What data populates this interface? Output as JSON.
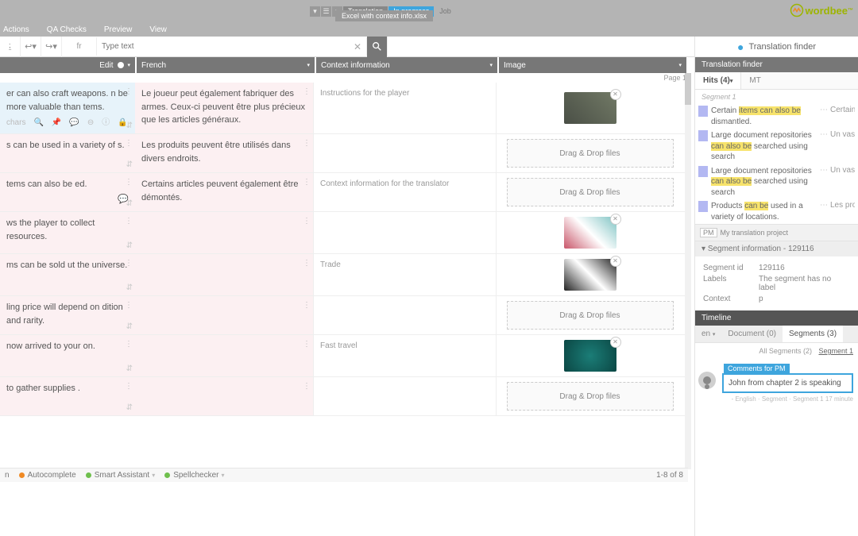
{
  "breadcrumb": {
    "translation": "Translation",
    "progress": "In progress",
    "job": "Job",
    "file": "Excel with context info.xlsx"
  },
  "brand": "wordbee",
  "menu": {
    "actions": "Actions",
    "qa": "QA Checks",
    "preview": "Preview",
    "view": "View"
  },
  "toolbar": {
    "lang": "fr",
    "type_ph": "Type text",
    "page": "1"
  },
  "cols": {
    "edit": "Edit",
    "fr": "French",
    "ctx": "Context information",
    "img": "Image"
  },
  "page_label": "Page 1",
  "drop": "Drag & Drop files",
  "chars": "chars",
  "rows": [
    {
      "en": "er can also craft weapons. n be more valuable than tems.",
      "fr": "Le joueur peut également fabriquer des armes. Ceux-ci peuvent être plus précieux que les articles généraux.",
      "ctx": "Instructions for the player",
      "img": "th1"
    },
    {
      "en": "s can be used in a variety of s.",
      "fr": "Les produits peuvent être utilisés dans divers endroits.",
      "ctx": "",
      "img": "drop"
    },
    {
      "en": "tems can also be ed.",
      "fr": "Certains articles peuvent également être démontés.",
      "ctx": "Context information for the translator",
      "img": "drop"
    },
    {
      "en": "ws the player to collect resources.",
      "fr": "",
      "ctx": "",
      "img": "th2"
    },
    {
      "en": "ms can be sold ut the universe.",
      "fr": "",
      "ctx": "Trade",
      "img": "th3"
    },
    {
      "en": "ling price will depend on dition and rarity.",
      "fr": "",
      "ctx": "",
      "img": "drop"
    },
    {
      "en": " now arrived to your on.",
      "fr": "",
      "ctx": "Fast travel",
      "img": "th4"
    },
    {
      "en": " to gather supplies .",
      "fr": "",
      "ctx": "",
      "img": "drop"
    }
  ],
  "status": {
    "autocomplete": "Autocomplete",
    "smart": "Smart Assistant",
    "spell": "Spellchecker",
    "range": "1-8 of 8"
  },
  "panel": {
    "title": "Translation finder",
    "sub": "Translation finder",
    "tabs": {
      "hits": "Hits (4)",
      "mt": "MT"
    },
    "segment": "Segment 1",
    "hits": [
      {
        "src_pre": "Certain ",
        "src_hl": "items can also be",
        "src_post": " dismantled.",
        "tgt": "Certains également"
      },
      {
        "src_pre": "Large document repositories ",
        "src_hl": "can also be",
        "src_post": " searched using search",
        "tgt": "Un vaste peut aus"
      },
      {
        "src_pre": "Large document repositories ",
        "src_hl": "can also be",
        "src_post": " searched using search",
        "tgt": "Un vaste peut aus"
      },
      {
        "src_pre": "Products ",
        "src_hl": "can be",
        "src_post": " used in a variety of locations.",
        "tgt": "Les prod dans div"
      }
    ],
    "pm": {
      "badge": "PM",
      "proj": "My translation project"
    },
    "seginfo_h": "Segment information - 129116",
    "seginfo": {
      "id_k": "Segment id",
      "id_v": "129116",
      "lbl_k": "Labels",
      "lbl_v": "The segment has no label",
      "ctx_k": "Context",
      "ctx_v": "p"
    },
    "timeline": "Timeline",
    "tl_tabs": {
      "en": "en",
      "doc": "Document (0)",
      "seg": "Segments (3)"
    },
    "tl_filter": {
      "all": "All Segments (2)",
      "cur": "Segment 1"
    },
    "comment": {
      "tag": "Comments for PM",
      "text": "John from chapter 2 is speaking",
      "meta": "- English · Segment · Segment 1     17 minute"
    }
  }
}
